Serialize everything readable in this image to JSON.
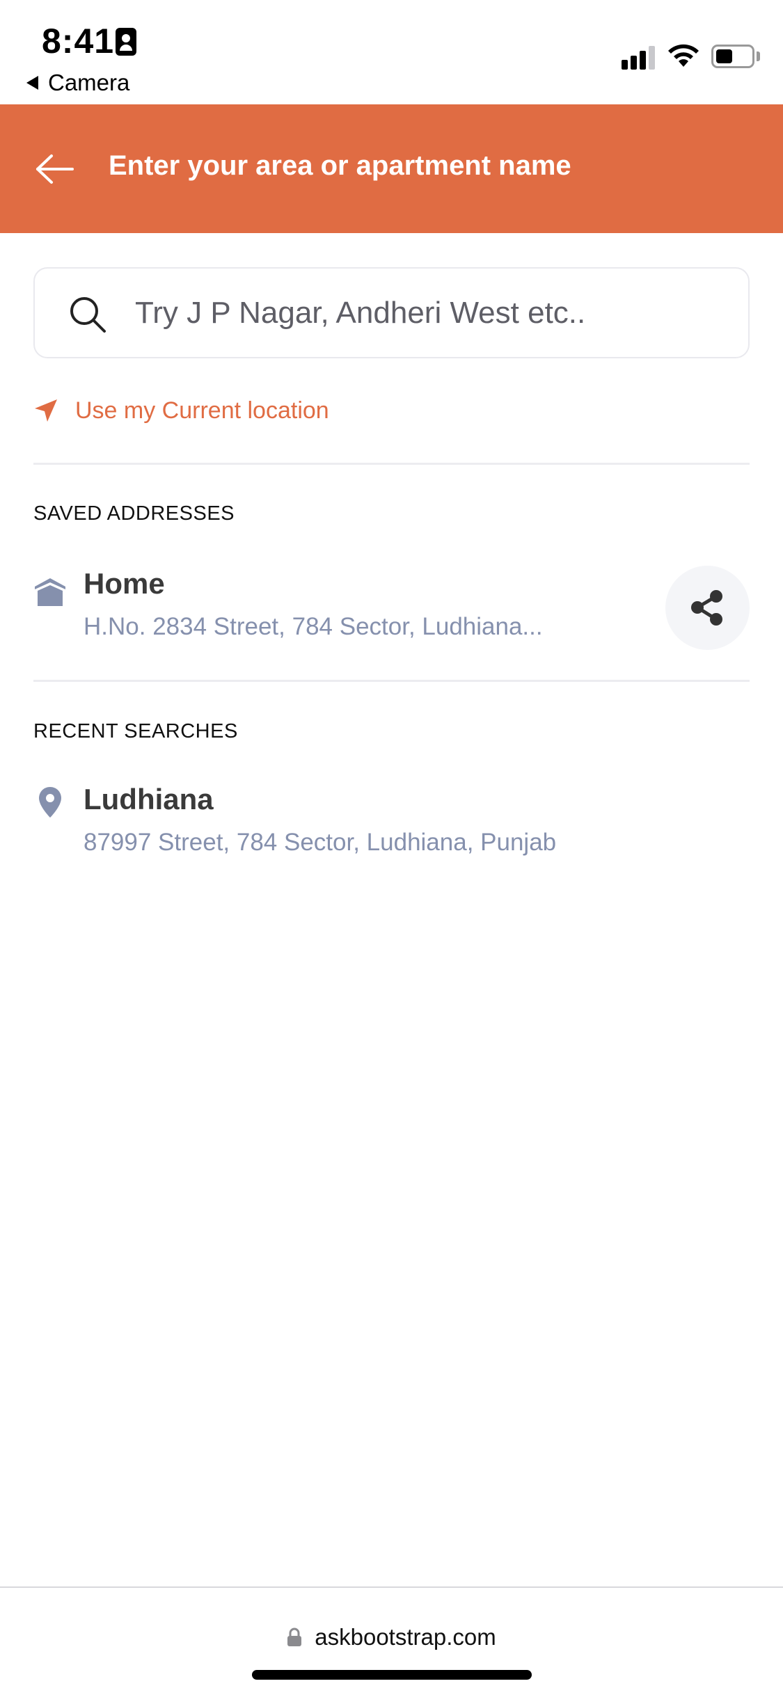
{
  "status_bar": {
    "time": "8:41",
    "back_app_label": "Camera",
    "battery_level": 0.45,
    "signal_bars": 3
  },
  "header": {
    "title": "Enter your area or apartment name",
    "background_color": "#e06c43"
  },
  "search": {
    "placeholder": "Try J P Nagar, Andheri West etc..",
    "value": ""
  },
  "current_location": {
    "label": "Use my Current location",
    "color": "#e06c43"
  },
  "saved_addresses": {
    "heading": "SAVED ADDRESSES",
    "items": [
      {
        "title": "Home",
        "detail": "H.No. 2834 Street, 784 Sector, Ludhiana...",
        "icon": "home-icon",
        "action_icon": "share-icon"
      }
    ]
  },
  "recent_searches": {
    "heading": "RECENT SEARCHES",
    "items": [
      {
        "title": "Ludhiana",
        "detail": "87997 Street, 784 Sector, Ludhiana, Punjab",
        "icon": "map-pin-icon"
      }
    ]
  },
  "browser": {
    "url": "askbootstrap.com",
    "secure": true
  }
}
